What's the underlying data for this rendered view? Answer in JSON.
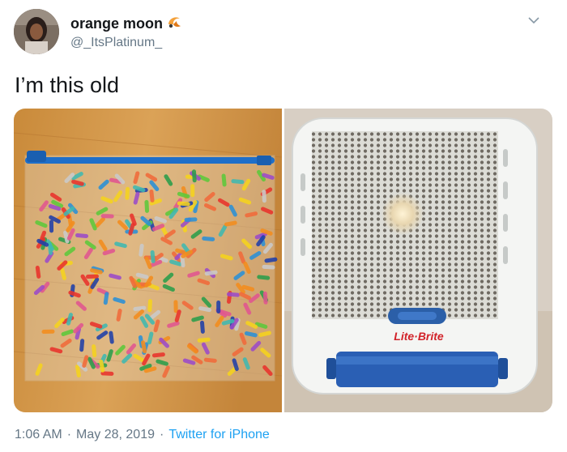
{
  "tweet": {
    "display_name": "orange moon",
    "name_emoji": "orange-moon-emoji-icon",
    "handle": "@_ItsPlatinum_",
    "text": "I’m this old",
    "time": "1:06 AM",
    "separator": "·",
    "date": "May 28, 2019",
    "source": "Twitter for iPhone"
  },
  "media": [
    {
      "id": "photo-lite-brite-pegs",
      "description": "zipper bag of colorful plastic pegs on a wooden table"
    },
    {
      "id": "photo-lite-brite-toy",
      "description": "white Lite-Brite toy with pegboard and blue roller"
    }
  ],
  "media_labels": {
    "toy_brand": "Lite·Brite"
  },
  "colors": {
    "link": "#1da1f2",
    "secondary_text": "#657786",
    "bag_zip": "#1f6fc9"
  }
}
